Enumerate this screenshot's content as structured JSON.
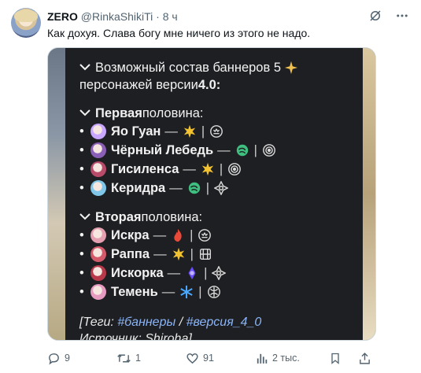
{
  "author": {
    "display_name": "ZERO",
    "handle": "@RinkaShikiTi",
    "separator": "·",
    "time": "8 ч"
  },
  "tweet_text": "Как дохуя. Слава богу мне ничего из этого не надо.",
  "image": {
    "title_line1": "Возможный состав баннеров 5",
    "title_line2_prefix": "персонажей версии ",
    "title_version": "4.0:",
    "section1": {
      "heading_bold": "Первая",
      "heading_rest": " половина:",
      "items": [
        {
          "name": "Яо Гуан",
          "dash": "—",
          "bar": "|",
          "avatar_color": "#c9a6ff",
          "element_icon": "imaginary-icon",
          "path_icon": "elation-icon"
        },
        {
          "name": "Чёрный Лебедь",
          "dash": "—",
          "bar": "|",
          "avatar_color": "#8b5fb8",
          "element_icon": "wind-icon",
          "path_icon": "nihility-icon"
        },
        {
          "name": "Гисиленса",
          "dash": "—",
          "bar": "|",
          "avatar_color": "#b84a6a",
          "element_icon": "imaginary-icon",
          "path_icon": "nihility-icon"
        },
        {
          "name": "Керидра",
          "dash": "—",
          "bar": "|",
          "avatar_color": "#7fc6e8",
          "element_icon": "wind-icon",
          "path_icon": "harmony-icon"
        }
      ]
    },
    "section2": {
      "heading_bold": "Вторая",
      "heading_rest": " половина:",
      "items": [
        {
          "name": "Искра",
          "dash": "—",
          "bar": "|",
          "avatar_color": "#e4a0b0",
          "element_icon": "fire-icon",
          "path_icon": "elation-icon"
        },
        {
          "name": "Раппа",
          "dash": "—",
          "bar": "|",
          "avatar_color": "#d35a6a",
          "element_icon": "imaginary-icon",
          "path_icon": "erudition-icon"
        },
        {
          "name": "Искорка",
          "dash": "—",
          "bar": "|",
          "avatar_color": "#b83a4a",
          "element_icon": "quantum-icon",
          "path_icon": "harmony-icon"
        },
        {
          "name": "Темень",
          "dash": "—",
          "bar": "|",
          "avatar_color": "#e59ac0",
          "element_icon": "ice-icon",
          "path_icon": "remembrance-icon"
        }
      ]
    },
    "tags_prefix": "[Теги: ",
    "tag1": "#баннеры",
    "tags_sep": " / ",
    "tag2": "#версия_4_0",
    "source_label": "Источник: Shiroha]"
  },
  "actions": {
    "replies": "9",
    "reposts": "1",
    "likes": "91",
    "views": "2 тыс."
  },
  "colors": {
    "text_primary": "#0f1419",
    "text_secondary": "#536471",
    "panel_bg": "#1e1f22",
    "tag_blue": "#8ab4f8",
    "star_gold": "#f0c050",
    "wind_green": "#3fbf7f",
    "fire_red": "#e84a3a",
    "imaginary_yellow": "#f2c230",
    "quantum_purple": "#6a4cff",
    "ice_blue": "#4aa8ff"
  }
}
